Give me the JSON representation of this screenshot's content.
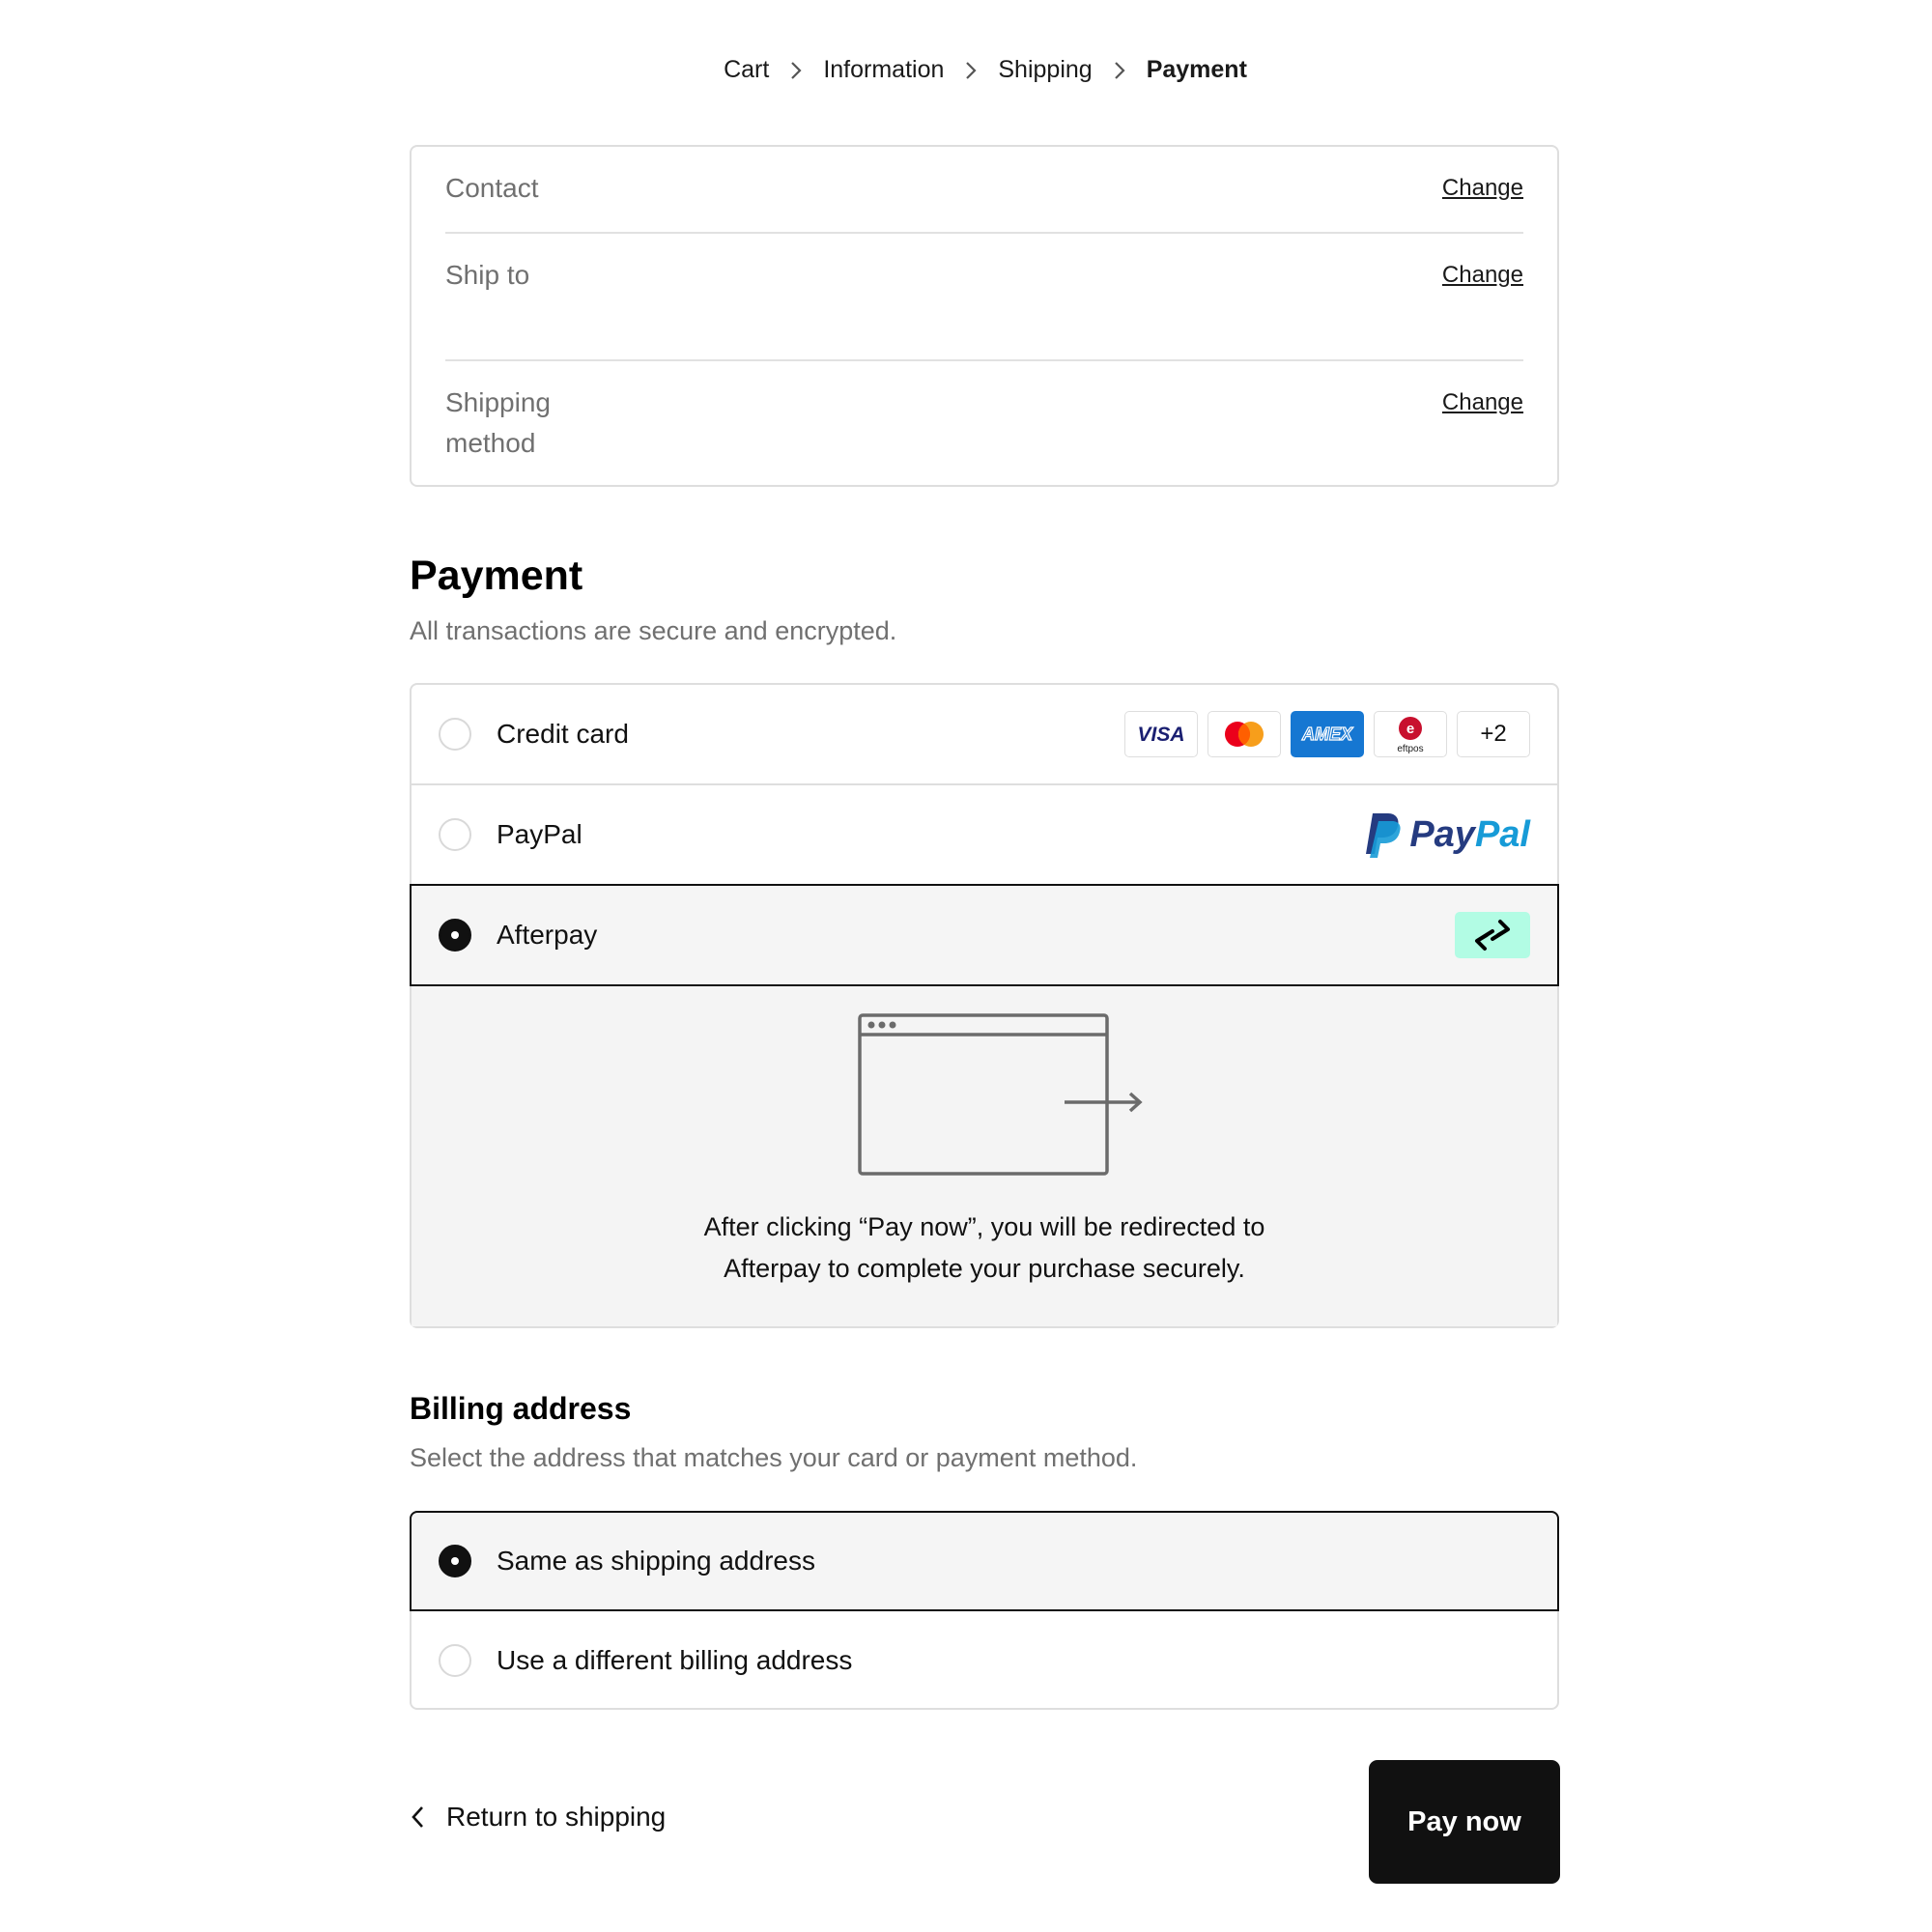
{
  "breadcrumb": {
    "items": [
      "Cart",
      "Information",
      "Shipping",
      "Payment"
    ]
  },
  "review": {
    "contact_label": "Contact",
    "ship_to_label": "Ship to",
    "shipping_method_label": "Shipping method",
    "change_label": "Change"
  },
  "payment": {
    "heading": "Payment",
    "subtitle": "All transactions are secure and encrypted.",
    "options": [
      {
        "label": "Credit card",
        "selected": false
      },
      {
        "label": "PayPal",
        "selected": false
      },
      {
        "label": "Afterpay",
        "selected": true
      }
    ],
    "card_brands": [
      "VISA",
      "mastercard",
      "AMEX",
      "eftpos"
    ],
    "more_cards": "+2",
    "paypal_logo_text": "PayPal",
    "afterpay_accent": "#b2fce4",
    "redirect_line1": "After clicking “Pay now”, you will be redirected to",
    "redirect_line2": "Afterpay to complete your purchase securely."
  },
  "billing": {
    "heading": "Billing address",
    "subtitle": "Select the address that matches your card or payment method.",
    "options": [
      {
        "label": "Same as shipping address",
        "selected": true
      },
      {
        "label": "Use a different billing address",
        "selected": false
      }
    ]
  },
  "footer": {
    "return_label": "Return to shipping",
    "pay_label": "Pay now"
  }
}
